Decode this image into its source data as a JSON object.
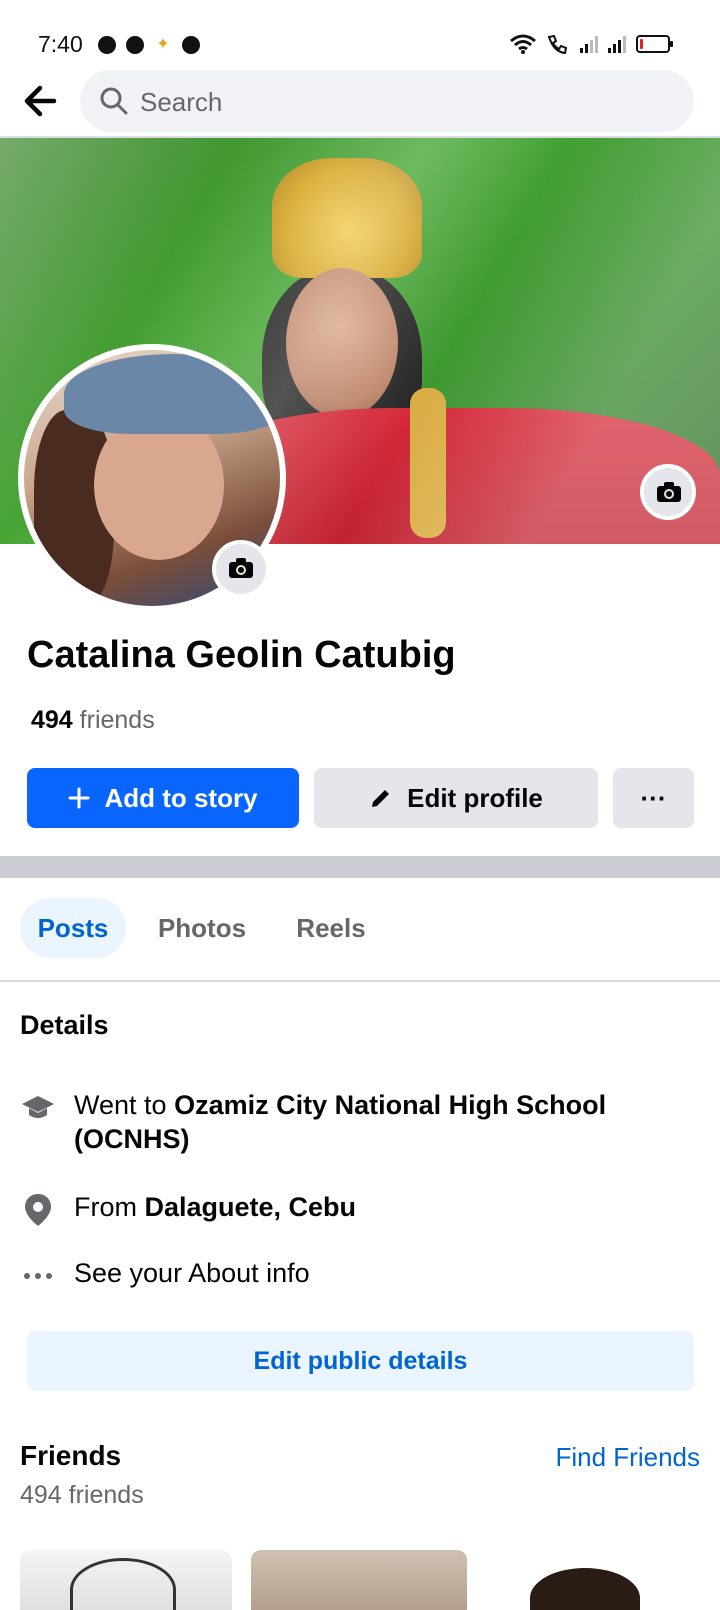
{
  "status_bar": {
    "time": "7:40",
    "app_icons": [
      "whatsapp-icon",
      "messenger-icon",
      "photos-icon",
      "chrome-icon"
    ],
    "right_icons": [
      "wifi-icon",
      "wifi-call-icon",
      "signal-icon",
      "signal-icon",
      "battery-icon"
    ]
  },
  "topbar": {
    "search_placeholder": "Search"
  },
  "profile": {
    "name": "Catalina Geolin Catubig",
    "friends_count": "494",
    "friends_label": "friends"
  },
  "actions": {
    "add_story": "Add to story",
    "edit_profile": "Edit profile",
    "more": "···"
  },
  "tabs": [
    {
      "label": "Posts",
      "active": true
    },
    {
      "label": "Photos",
      "active": false
    },
    {
      "label": "Reels",
      "active": false
    }
  ],
  "details": {
    "title": "Details",
    "school_prefix": "Went to ",
    "school_name": "Ozamiz City National High School (OCNHS)",
    "from_prefix": "From ",
    "from_place": "Dalaguete, Cebu",
    "about": "See your About info",
    "edit_button": "Edit public details"
  },
  "friends": {
    "title": "Friends",
    "count_text": "494 friends",
    "find_link": "Find Friends"
  },
  "colors": {
    "accent": "#0866ff",
    "link": "#0064d1",
    "light_accent_bg": "#ebf5ff",
    "button_gray": "#e4e6eb"
  }
}
